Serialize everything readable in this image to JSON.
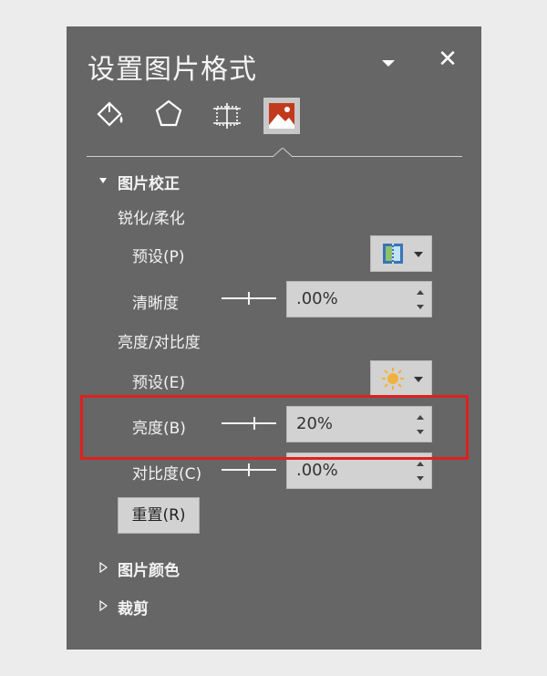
{
  "panel": {
    "title": "设置图片格式",
    "tabs": [
      "fill-line-icon",
      "effects-icon",
      "size-properties-icon",
      "picture-icon"
    ],
    "active_tab": "picture-icon"
  },
  "corrections": {
    "section_title": "图片校正",
    "sharpen_group": "锐化/柔化",
    "sharpen_preset_label": "预设(P)",
    "sharpness_label": "清晰度",
    "sharpness_value": ".00%",
    "brightness_group": "亮度/对比度",
    "brightness_preset_label": "预设(E)",
    "brightness_label": "亮度(B)",
    "brightness_value": "20%",
    "contrast_label": "对比度(C)",
    "contrast_value": ".00%",
    "reset_label": "重置(R)"
  },
  "sections": {
    "picture_color": "图片颜色",
    "crop": "裁剪"
  },
  "colors": {
    "panel_bg": "#666666",
    "highlight": "#e02020"
  }
}
